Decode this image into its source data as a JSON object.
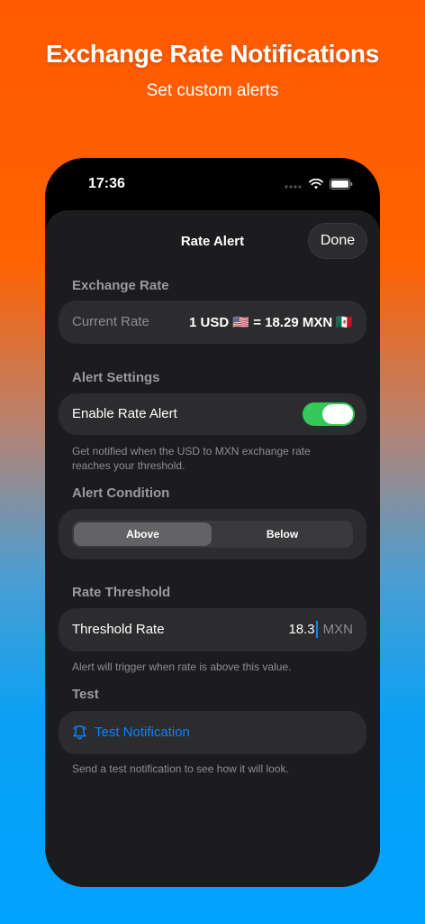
{
  "promo": {
    "title": "Exchange Rate Notifications",
    "subtitle": "Set custom alerts"
  },
  "status_bar": {
    "time": "17:36",
    "icons": [
      "signal-dots-icon",
      "wifi-icon",
      "battery-icon"
    ]
  },
  "nav": {
    "title": "Rate Alert",
    "done_label": "Done"
  },
  "exchange_rate": {
    "header": "Exchange Rate",
    "label": "Current Rate",
    "value": "1 USD 🇺🇸 = 18.29 MXN 🇲🇽"
  },
  "alert_settings": {
    "header": "Alert Settings",
    "toggle_label": "Enable Rate Alert",
    "toggle_on": true,
    "footnote": "Get notified when the USD to MXN exchange rate reaches your threshold."
  },
  "alert_condition": {
    "header": "Alert Condition",
    "options": [
      "Above",
      "Below"
    ],
    "selected": "Above"
  },
  "threshold": {
    "header": "Rate Threshold",
    "label": "Threshold Rate",
    "value": "18.3",
    "unit": "MXN",
    "footnote": "Alert will trigger when rate is above this value."
  },
  "test": {
    "header": "Test",
    "button_label": "Test Notification",
    "footnote": "Send a test notification to see how it will look."
  },
  "colors": {
    "accent_blue": "#0A84FF",
    "toggle_green": "#34C759",
    "background_top": "#FF5A00",
    "background_bottom": "#00A3FF"
  }
}
